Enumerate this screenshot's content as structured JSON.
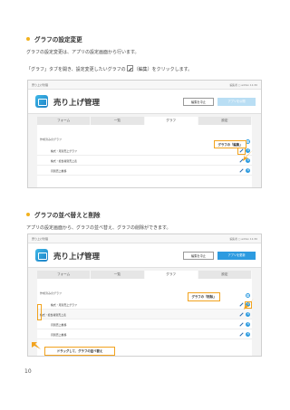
{
  "section1": {
    "title": "グラフの設定変更",
    "line1": "グラフの設定変更は、アプリの設定画面から行います。",
    "line2_before": "「グラフ」タブを開き、設定変更したいグラフの",
    "line2_after": "（編集）をクリックします。",
    "screenshot": {
      "breadcrumb": "売り上げ管理",
      "user_info": "編集者 ▢ admin 11:30",
      "app_title": "売り上げ管理",
      "stop_button": "編集を中止",
      "public_button": "アプリを公開",
      "tabs": [
        "フォーム",
        "一覧",
        "グラフ",
        "設定"
      ],
      "active_tab": "グラフ",
      "panel_label": "作成済みのグラフ",
      "rows": [
        "株式・月別売上グラフ",
        "株式・担当者別売上表",
        "月別売上推移"
      ],
      "callout": "グラフの「編集」"
    }
  },
  "section2": {
    "title": "グラフの並べ替えと削除",
    "line1": "アプリの設定画面から、グラフの並べ替え、グラフの削除ができます。",
    "screenshot": {
      "breadcrumb": "売り上げ管理",
      "user_info": "編集者 ▢ admin 11:30",
      "app_title": "売り上げ管理",
      "stop_button": "編集を中止",
      "public_button": "アプリを更新",
      "tabs": [
        "フォーム",
        "一覧",
        "グラフ",
        "設定"
      ],
      "active_tab": "グラフ",
      "panel_label": "作成済みのグラフ",
      "rows": [
        "株式・月別売上グラフ",
        "株式・担当者別売上表",
        "月別売上推移",
        "月別売上推移"
      ],
      "callout_delete": "グラフの「削除」",
      "callout_drag": "ドラッグして、グラフの並べ替え"
    }
  },
  "page_number": "10",
  "colors": {
    "accent": "#f2a31e",
    "bullet": "#f2b21e",
    "primary": "#2d9be0"
  }
}
